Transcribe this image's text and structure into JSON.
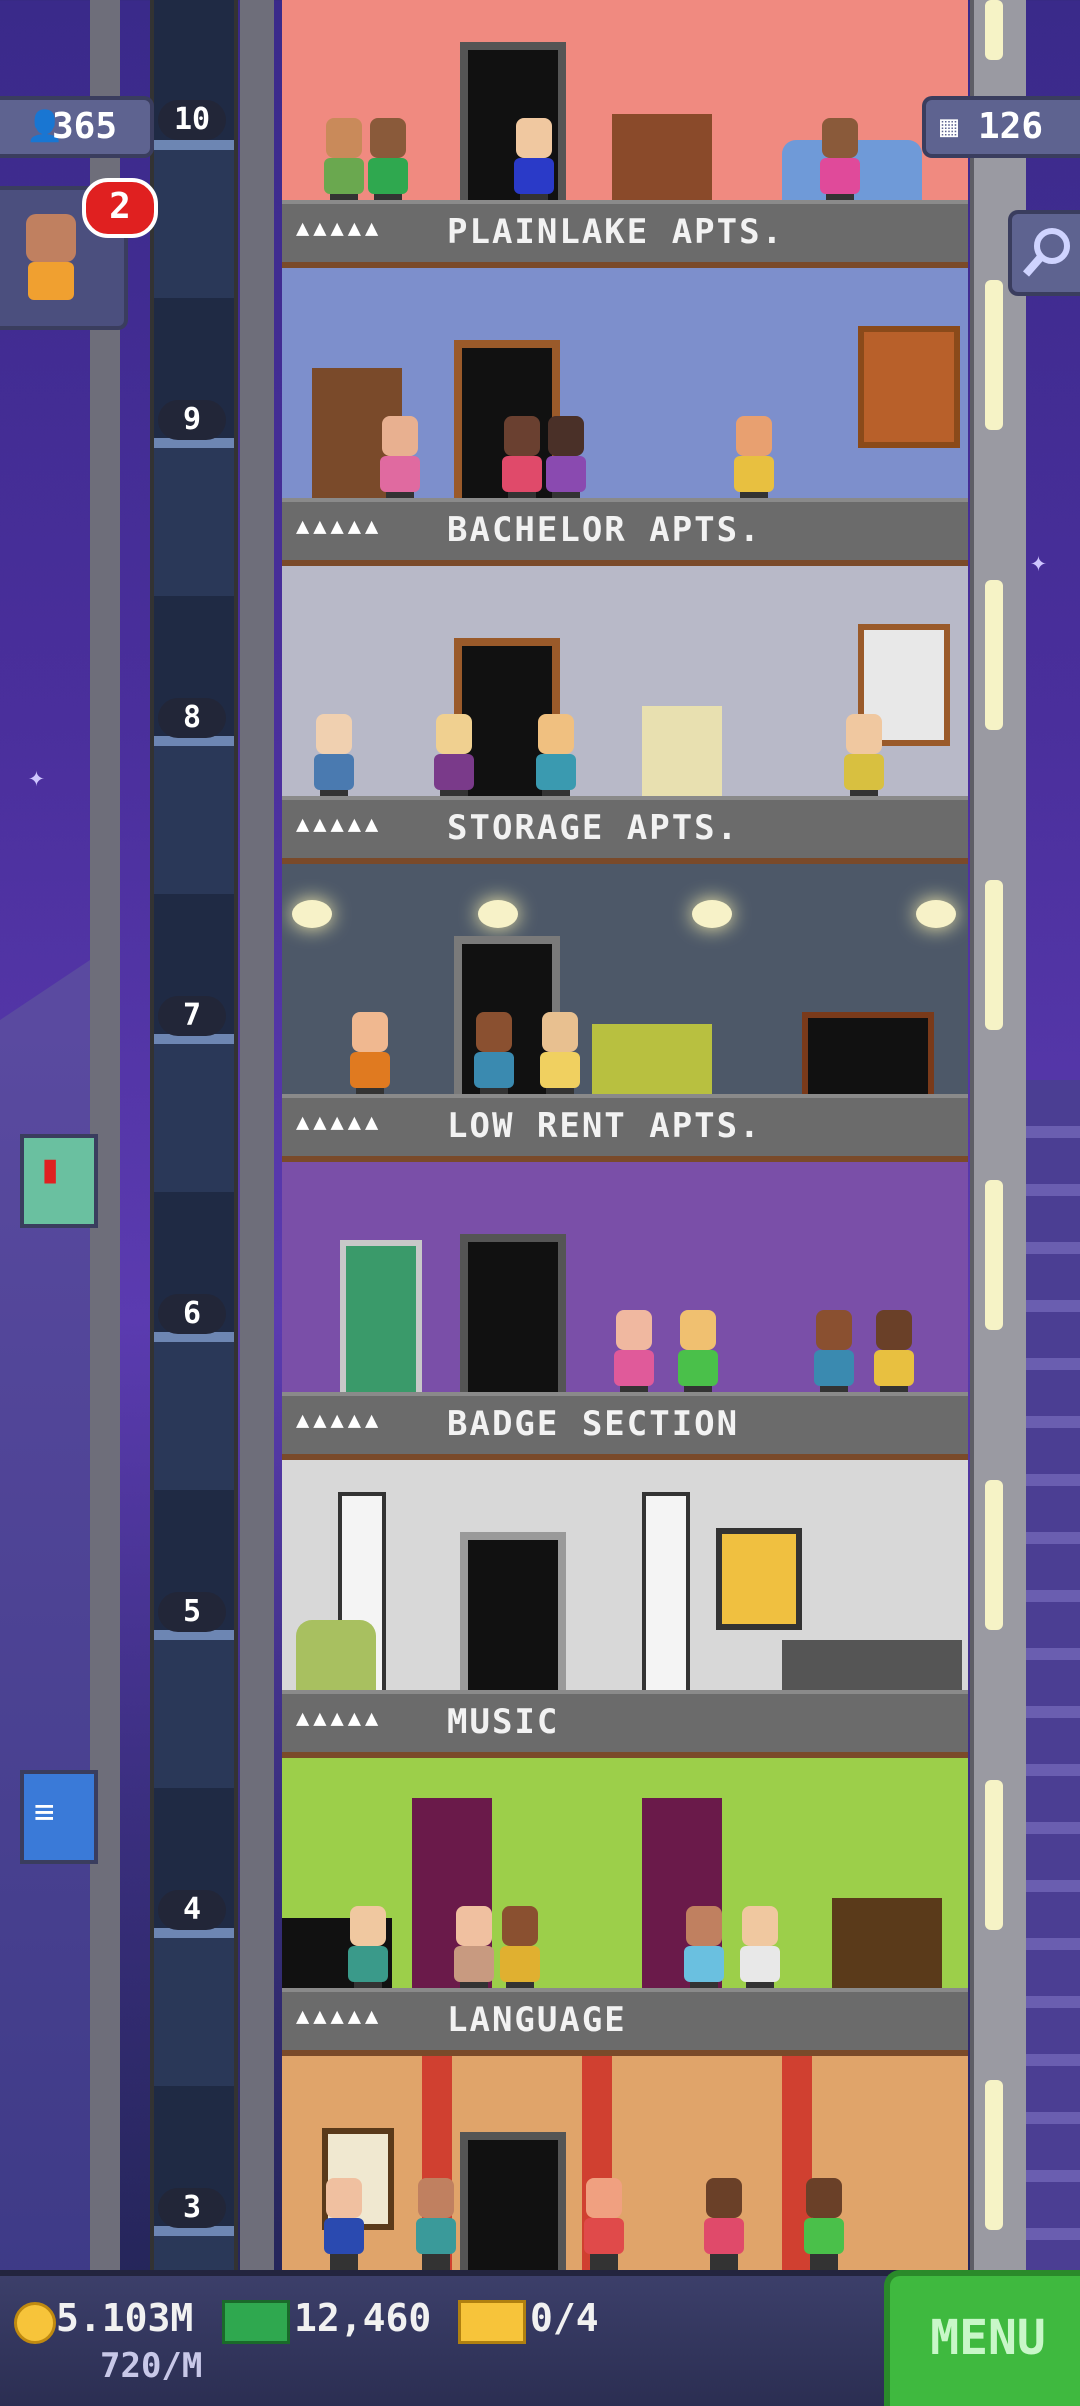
{
  "hud": {
    "population": "365",
    "top_floor_number": "10",
    "floors_count": "126",
    "notification_count": "2",
    "coins": "5.103M",
    "coin_rate": "720/M",
    "bux": "12,460",
    "tickets": "0/4",
    "menu_label": "MENU"
  },
  "floors": [
    {
      "number": "",
      "name": "PLAINLAKE APTS.",
      "stars": "▲▲▲▲▲",
      "wall": "#f08a80"
    },
    {
      "number": "9",
      "name": "BACHELOR APTS.",
      "stars": "▲▲▲▲▲",
      "wall": "#7d8fcc"
    },
    {
      "number": "8",
      "name": "STORAGE APTS.",
      "stars": "▲▲▲▲▲",
      "wall": "#b8b9c8"
    },
    {
      "number": "7",
      "name": "LOW RENT APTS.",
      "stars": "▲▲▲▲▲",
      "wall": "#4d5868"
    },
    {
      "number": "6",
      "name": "BADGE SECTION",
      "stars": "▲▲▲▲▲",
      "wall": "#7a4fa8"
    },
    {
      "number": "5",
      "name": "MUSIC",
      "stars": "▲▲▲▲▲",
      "wall": "#d8d8d8"
    },
    {
      "number": "4",
      "name": "LANGUAGE",
      "stars": "▲▲▲▲▲",
      "wall": "#9ccf4a"
    },
    {
      "number": "3",
      "name": "",
      "stars": "",
      "wall": "#e0a46a"
    }
  ],
  "icons": {
    "population": "person-icon",
    "floors": "building-icon",
    "search": "magnifier-icon",
    "coins": "coin-icon",
    "bux": "bux-icon",
    "tickets": "ticket-icon"
  }
}
